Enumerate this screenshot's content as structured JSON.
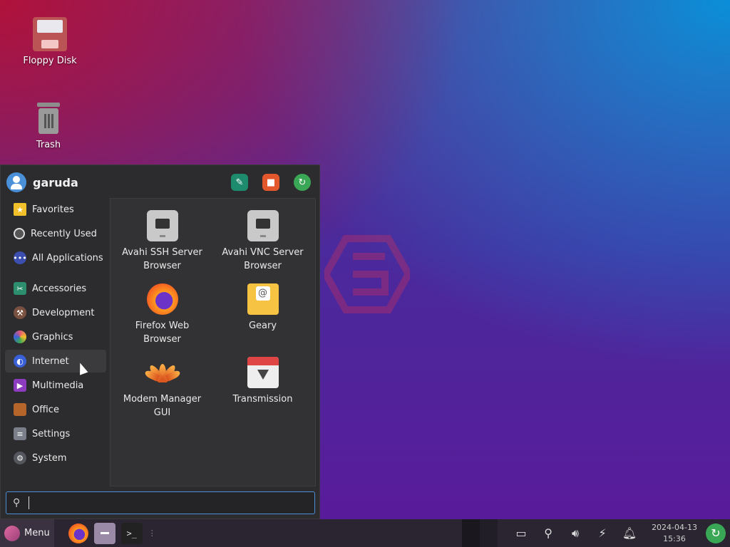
{
  "desktop": {
    "icons": [
      {
        "label": "Floppy Disk",
        "icon": "floppy-disk-icon"
      },
      {
        "label": "Trash",
        "icon": "trash-icon"
      }
    ]
  },
  "menu": {
    "username": "garuda",
    "header_buttons": [
      {
        "icon": "settings-manager-icon",
        "color": "#1e8a6e"
      },
      {
        "icon": "lock-screen-icon",
        "color": "#e2572c"
      },
      {
        "icon": "logout-icon",
        "color": "#3aa757"
      }
    ],
    "categories": [
      {
        "label": "Favorites",
        "icon": "star-icon",
        "color": "#f2c02b"
      },
      {
        "label": "Recently Used",
        "icon": "clock-icon",
        "color": "#555555"
      },
      {
        "label": "All Applications",
        "icon": "dots-icon",
        "color": "#3c4fae"
      },
      {
        "label": "Accessories",
        "icon": "accessories-icon",
        "color": "#2d8e6e"
      },
      {
        "label": "Development",
        "icon": "hammer-icon",
        "color": "#7a5140"
      },
      {
        "label": "Graphics",
        "icon": "graphics-icon",
        "color": "#e0567a"
      },
      {
        "label": "Internet",
        "icon": "globe-icon",
        "color": "#3a60d8"
      },
      {
        "label": "Multimedia",
        "icon": "multimedia-icon",
        "color": "#8d3bbf"
      },
      {
        "label": "Office",
        "icon": "briefcase-icon",
        "color": "#b5652a"
      },
      {
        "label": "Settings",
        "icon": "settings-icon",
        "color": "#7b7f8a"
      },
      {
        "label": "System",
        "icon": "system-icon",
        "color": "#54575e"
      }
    ],
    "active_category": "Internet",
    "apps": [
      {
        "label": "Avahi SSH Server Browser",
        "line1": "Avahi SSH Server",
        "line2": "Browser",
        "icon": "network-icon"
      },
      {
        "label": "Avahi VNC Server Browser",
        "line1": "Avahi VNC Server",
        "line2": "Browser",
        "icon": "network-icon"
      },
      {
        "label": "Firefox Web Browser",
        "line1": "Firefox Web",
        "line2": "Browser",
        "icon": "firefox-icon"
      },
      {
        "label": "Geary",
        "line1": "Geary",
        "line2": "",
        "icon": "mail-icon"
      },
      {
        "label": "Modem Manager GUI",
        "line1": "Modem Manager",
        "line2": "GUI",
        "icon": "modem-manager-icon"
      },
      {
        "label": "Transmission",
        "line1": "Transmission",
        "line2": "",
        "icon": "transmission-icon"
      }
    ],
    "search": {
      "value": "",
      "placeholder": ""
    }
  },
  "taskbar": {
    "menu_label": "Menu",
    "clock": {
      "date": "2024-04-13",
      "time": "15:36"
    }
  }
}
